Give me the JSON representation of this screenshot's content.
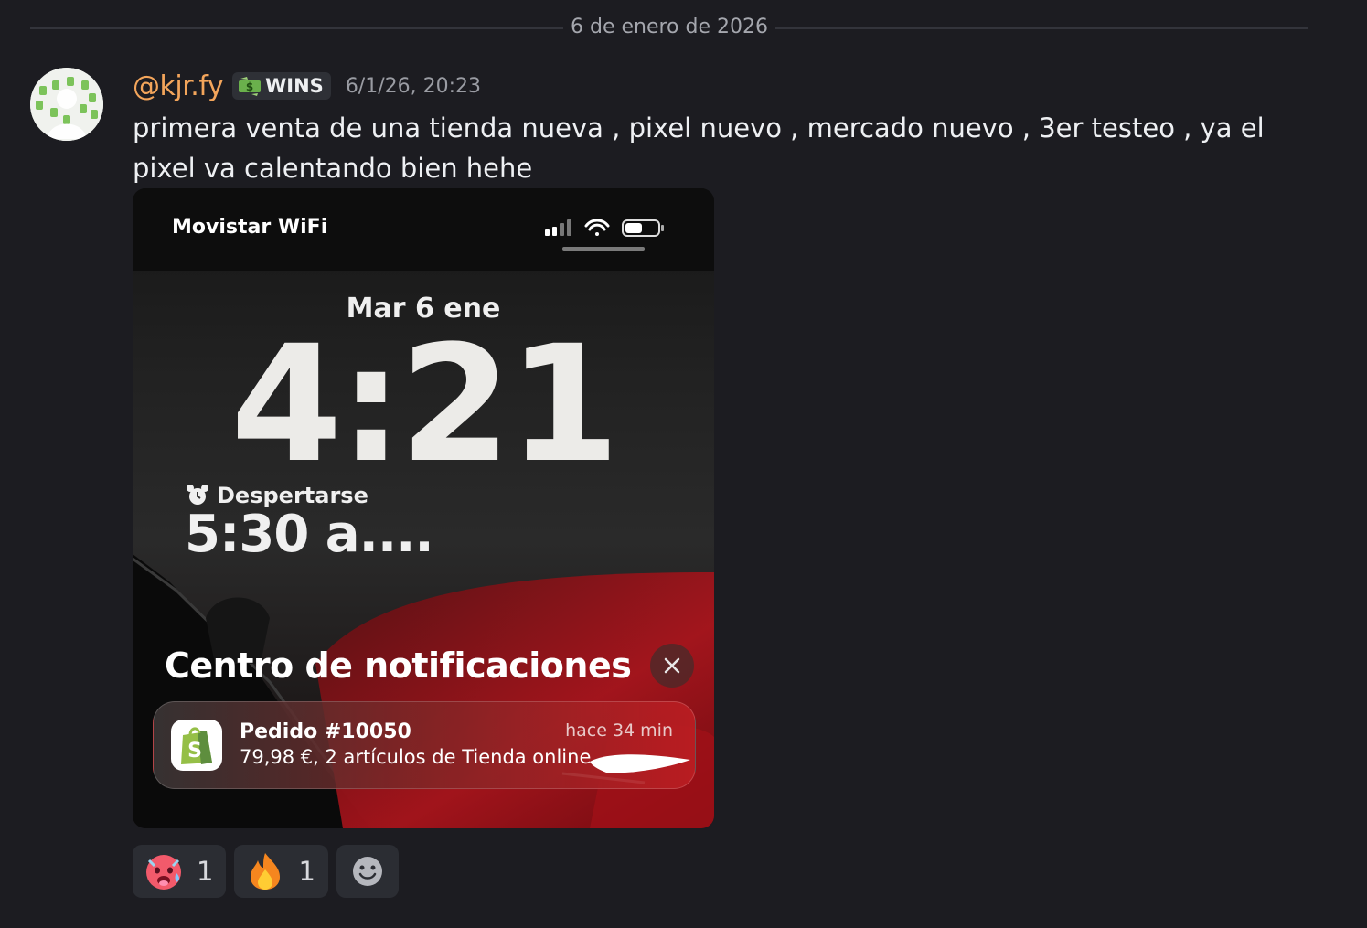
{
  "divider": {
    "date": "6 de enero de 2026"
  },
  "message": {
    "username": "@kjr.fy",
    "role_tag": {
      "icon": "money-icon",
      "label": "WINS"
    },
    "timestamp": "6/1/26, 20:23",
    "text": "primera venta de una  tienda nueva , pixel nuevo , mercado nuevo , 3er testeo , ya el pixel va calentando bien hehe"
  },
  "attachment": {
    "status_bar": {
      "carrier": "Movistar WiFi"
    },
    "lock_screen": {
      "date": "Mar 6 ene",
      "time": "4:21",
      "alarm_label": "Despertarse",
      "alarm_time": "5:30 a...."
    },
    "notification_center": {
      "title": "Centro de notificaciones",
      "notification": {
        "app_icon": "shopify-icon",
        "title": "Pedido #10050",
        "time": "hace 34 min",
        "body": "79,98 €, 2 artículos de Tienda online"
      }
    }
  },
  "reactions": [
    {
      "emoji": "hot-face-emoji",
      "count": "1"
    },
    {
      "emoji": "fire-emoji",
      "count": "1"
    }
  ],
  "add_reaction": {
    "icon": "add-reaction-icon"
  }
}
